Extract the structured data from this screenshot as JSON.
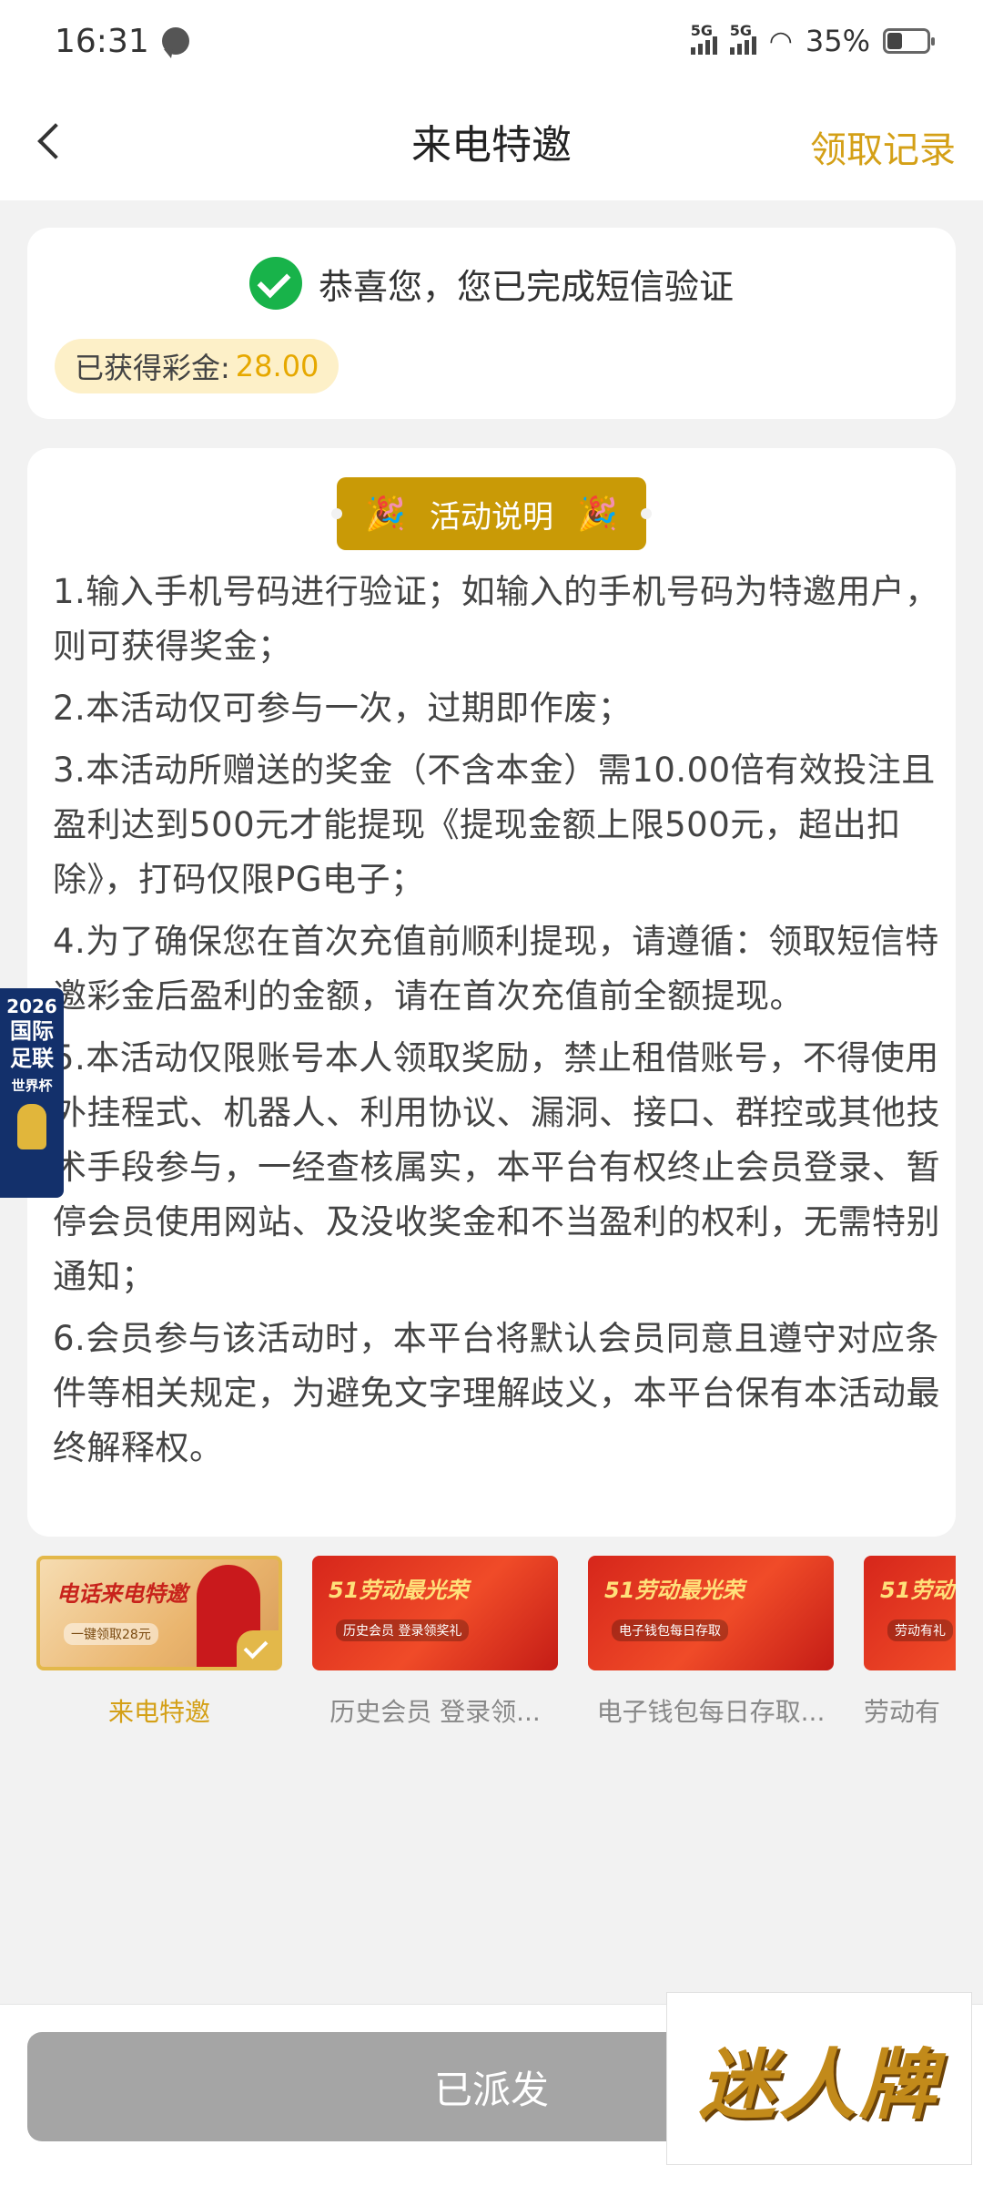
{
  "status_bar": {
    "time": "16:31",
    "signal1_label": "5G",
    "signal2_label": "5G",
    "battery": "35%"
  },
  "header": {
    "title": "来电特邀",
    "right_link": "领取记录"
  },
  "success": {
    "message": "恭喜您，您已完成短信验证",
    "bonus_label": "已获得彩金:",
    "bonus_value": "28.00"
  },
  "rules": {
    "banner_title": "活动说明",
    "items": [
      "1.输入手机号码进行验证；如输入的手机号码为特邀用户，则可获得奖金；",
      "2.本活动仅可参与一次，过期即作废；",
      "3.本活动所赠送的奖金（不含本金）需10.00倍有效投注且盈利达到500元才能提现《提现金额上限500元，超出扣除》，打码仅限PG电子；",
      "4.为了确保您在首次充值前顺利提现，请遵循：领取短信特邀彩金后盈利的金额，请在首次充值前全额提现。",
      "5.本活动仅限账号本人领取奖励，禁止租借账号，不得使用外挂程式、机器人、利用协议、漏洞、接口、群控或其他技术手段参与，一经查核属实，本平台有权终止会员登录、暂停会员使用网站、及没收奖金和不当盈利的权利，无需特别通知；",
      "6.会员参与该活动时，本平台将默认会员同意且遵守对应条件等相关规定，为避免文字理解歧义，本平台保有本活动最终解释权。"
    ]
  },
  "float_badge": {
    "line1": "2026",
    "line2": "国际",
    "line3": "足联",
    "line4": "世界杯"
  },
  "promos": [
    {
      "label": "来电特邀",
      "banner_title": "电话来电特邀",
      "banner_sub": "一键领取28元",
      "active": true
    },
    {
      "label": "历史会员 登录领...",
      "banner_title": "51劳动最光荣",
      "banner_sub": "历史会员 登录领奖礼",
      "active": false
    },
    {
      "label": "电子钱包每日存取...",
      "banner_title": "51劳动最光荣",
      "banner_sub": "电子钱包每日存取",
      "active": false
    },
    {
      "label": "劳动有",
      "banner_title": "51劳动",
      "banner_sub": "劳动有礼",
      "active": false
    }
  ],
  "bottom": {
    "button_label": "已派发",
    "logo_text": "迷人牌"
  },
  "colors": {
    "accent_gold": "#d4a017",
    "success_green": "#18b34a",
    "disabled_gray": "#a5a5a5"
  }
}
